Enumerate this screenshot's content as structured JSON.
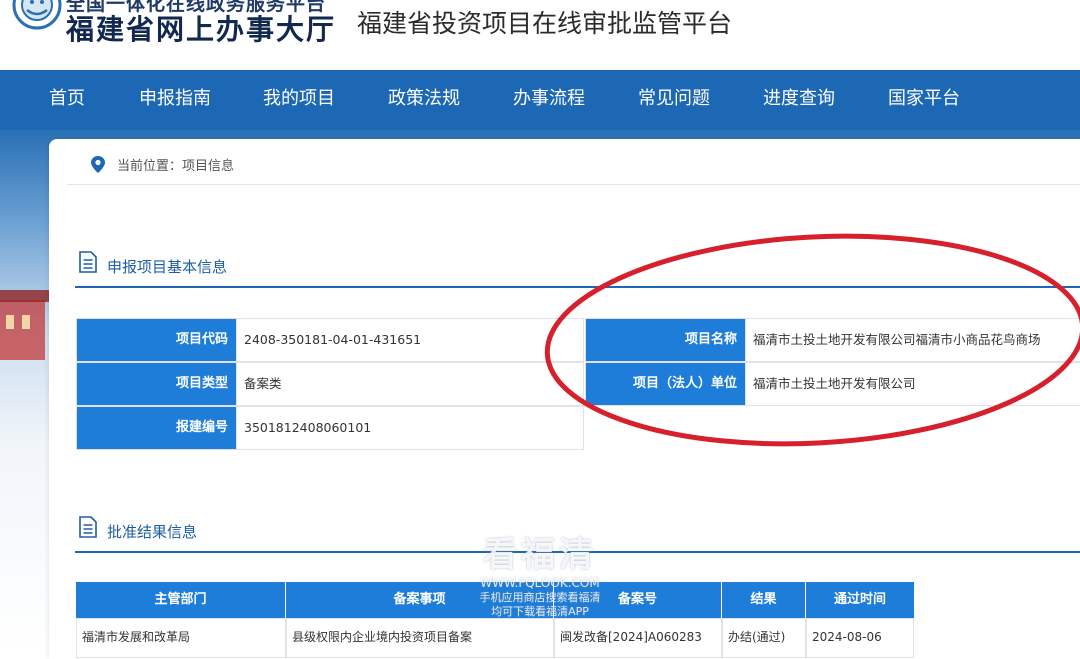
{
  "header": {
    "brand_sub": "全国一体化在线政务服务平台",
    "brand_main": "福建省网上办事大厅",
    "platform_title": "福建省投资项目在线审批监管平台"
  },
  "nav": {
    "items": [
      {
        "label": "首页"
      },
      {
        "label": "申报指南"
      },
      {
        "label": "我的项目"
      },
      {
        "label": "政策法规"
      },
      {
        "label": "办事流程"
      },
      {
        "label": "常见问题"
      },
      {
        "label": "进度查询"
      },
      {
        "label": "国家平台"
      }
    ]
  },
  "breadcrumb": {
    "text": "当前位置：项目信息"
  },
  "basic_info": {
    "title": "申报项目基本信息",
    "fields": [
      {
        "label": "项目代码",
        "value": "2408-350181-04-01-431651"
      },
      {
        "label": "项目类型",
        "value": "备案类"
      },
      {
        "label": "报建编号",
        "value": "3501812408060101"
      },
      {
        "label": "项目名称",
        "value": "福清市土投土地开发有限公司福清市小商品花鸟商场"
      },
      {
        "label": "项目（法人）单位",
        "value": "福清市土投土地开发有限公司"
      }
    ]
  },
  "approval": {
    "title": "批准结果信息",
    "columns": [
      "主管部门",
      "备案事项",
      "备案号",
      "结果",
      "通过时间"
    ],
    "rows": [
      [
        "福清市发展和改革局",
        "县级权限内企业境内投资项目备案",
        "闽发改备[2024]A060283",
        "办结(通过)",
        "2024-08-06"
      ]
    ]
  },
  "watermark": {
    "main": "看福清",
    "url": "WWW.FQLOOK.COM",
    "tip1": "手机应用商店搜索看福清",
    "tip2": "均可下载看福清APP"
  },
  "colors": {
    "nav_blue": "#1d68b4",
    "label_blue": "#1d7dd9",
    "annotation_red": "#d6202b"
  }
}
